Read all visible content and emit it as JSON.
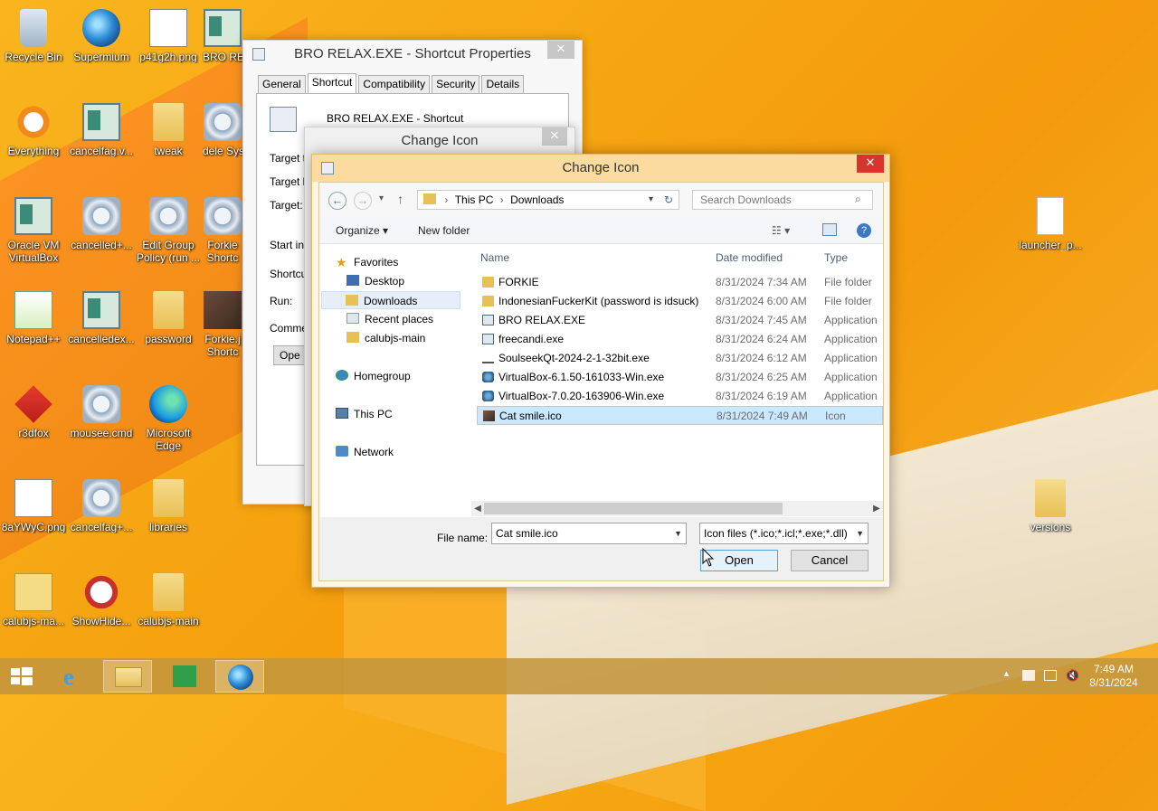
{
  "desktop": {
    "icons": [
      {
        "label": "Recycle Bin"
      },
      {
        "label": "Supermium"
      },
      {
        "label": "p41g2h.png"
      },
      {
        "label": "BRO RELAX..."
      },
      {
        "label": "Everything"
      },
      {
        "label": "cancelfag.v..."
      },
      {
        "label": "tweak"
      },
      {
        "label": "dele Systems"
      },
      {
        "label": "Oracle VM VirtualBox"
      },
      {
        "label": "cancelled+..."
      },
      {
        "label": "Edit Group Policy (run ..."
      },
      {
        "label": "Forkie Shortc"
      },
      {
        "label": "Notepad++"
      },
      {
        "label": "cancelledex..."
      },
      {
        "label": "password"
      },
      {
        "label": "Forkie.j Shortc"
      },
      {
        "label": "r3dfox"
      },
      {
        "label": "mousee.cmd"
      },
      {
        "label": "Microsoft Edge"
      },
      {
        "label": "8aYWyC.png"
      },
      {
        "label": "cancelfag+..."
      },
      {
        "label": "libraries"
      },
      {
        "label": "calubjs-ma..."
      },
      {
        "label": "ShowHide..."
      },
      {
        "label": "calubjs-main"
      },
      {
        "label": "launcher_p..."
      },
      {
        "label": "versions"
      }
    ]
  },
  "props_window": {
    "title": "BRO RELAX.EXE - Shortcut Properties",
    "close": "✕",
    "tabs": [
      "General",
      "Shortcut",
      "Compatibility",
      "Security",
      "Details"
    ],
    "shortcut_name": "BRO RELAX.EXE - Shortcut",
    "fields": [
      "Target ty",
      "Target lc",
      "Target:",
      "Start in:",
      "Shortcut",
      "Run:",
      "Commen"
    ],
    "open_btn": "Ope"
  },
  "change_icon_back": {
    "title": "Change Icon",
    "close": "✕"
  },
  "change_icon": {
    "title": "Change Icon",
    "close": "✕",
    "nav": {
      "back": "←",
      "forward": "→",
      "recent": "▾",
      "up": "↑",
      "refresh": "↻"
    },
    "breadcrumb": [
      "This PC",
      "Downloads"
    ],
    "search_placeholder": "Search Downloads",
    "toolbar": {
      "organize": "Organize ▾",
      "new_folder": "New folder",
      "view": "☷ ▾",
      "help": "?"
    },
    "navpane": {
      "favorites": "Favorites",
      "items": [
        "Desktop",
        "Downloads",
        "Recent places",
        "calubjs-main"
      ],
      "homegroup": "Homegroup",
      "this_pc": "This PC",
      "network": "Network"
    },
    "columns": {
      "name": "Name",
      "date": "Date modified",
      "type": "Type"
    },
    "files": [
      {
        "name": "FORKIE",
        "date": "8/31/2024 7:34 AM",
        "type": "File folder",
        "icon": "folder-icon"
      },
      {
        "name": "IndonesianFuckerKit (password is idsuck)",
        "date": "8/31/2024 6:00 AM",
        "type": "File folder",
        "icon": "folder-icon"
      },
      {
        "name": "BRO RELAX.EXE",
        "date": "8/31/2024 7:45 AM",
        "type": "Application",
        "icon": "app-icon"
      },
      {
        "name": "freecandi.exe",
        "date": "8/31/2024 6:24 AM",
        "type": "Application",
        "icon": "app-icon"
      },
      {
        "name": "SoulseekQt-2024-2-1-32bit.exe",
        "date": "8/31/2024 6:12 AM",
        "type": "Application",
        "icon": "installer-icon"
      },
      {
        "name": "VirtualBox-6.1.50-161033-Win.exe",
        "date": "8/31/2024 6:25 AM",
        "type": "Application",
        "icon": "virtualbox-icon"
      },
      {
        "name": "VirtualBox-7.0.20-163906-Win.exe",
        "date": "8/31/2024 6:19 AM",
        "type": "Application",
        "icon": "virtualbox-icon"
      },
      {
        "name": "Cat smile.ico",
        "date": "8/31/2024 7:49 AM",
        "type": "Icon",
        "icon": "image-icon",
        "selected": true
      }
    ],
    "filename_label": "File name:",
    "filename_value": "Cat smile.ico",
    "filter": "Icon files (*.ico;*.icl;*.exe;*.dll)",
    "open": "Open",
    "cancel": "Cancel"
  },
  "taskbar": {
    "time": "7:49 AM",
    "date": "8/31/2024",
    "show_hidden": "▲"
  }
}
